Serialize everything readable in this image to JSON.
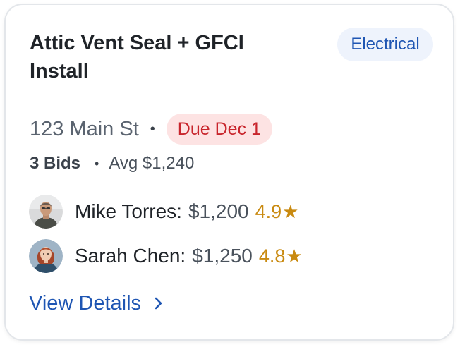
{
  "job": {
    "title": "Attic Vent Seal + GFCI Install",
    "category": "Electrical",
    "address": "123 Main St",
    "separator": "•",
    "due": "Due Dec 1"
  },
  "bids_summary": {
    "count_label": "3 Bids",
    "separator": "•",
    "average_label": "Avg $1,240"
  },
  "bids": [
    {
      "name": "Mike Torres:",
      "amount": "$1,200",
      "rating": "4.9",
      "star": "★",
      "avatar_icon": "avatar-photo-man"
    },
    {
      "name": "Sarah Chen:",
      "amount": "$1,250",
      "rating": "4.8",
      "star": "★",
      "avatar_icon": "avatar-photo-woman"
    }
  ],
  "link": {
    "label": "View Details",
    "icon": "chevron-right-icon"
  },
  "colors": {
    "accent_blue": "#1f56b3",
    "due_red": "#c8252c",
    "due_bg": "#fde3e3",
    "rating_gold": "#c98a10",
    "badge_bg": "#eef3fc"
  }
}
